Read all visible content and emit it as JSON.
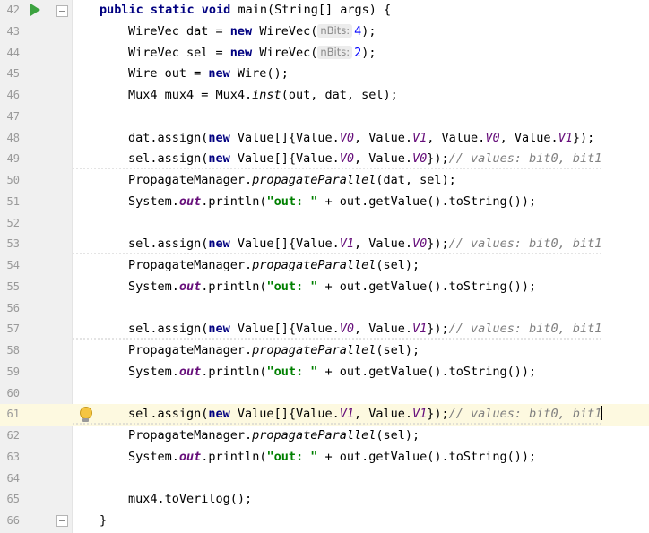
{
  "editor": {
    "line_numbers": [
      "42",
      "43",
      "44",
      "45",
      "46",
      "47",
      "48",
      "49",
      "50",
      "51",
      "52",
      "53",
      "54",
      "55",
      "56",
      "57",
      "58",
      "59",
      "60",
      "61",
      "62",
      "63",
      "64",
      "65",
      "66"
    ],
    "hints": {
      "nbits_label": "nBits:",
      "dat_value": "4",
      "sel_value": "2"
    },
    "code": {
      "l42": {
        "kw": "public static void",
        "rest": " main(String[] args) {"
      },
      "l43": {
        "a": "WireVec dat = ",
        "kw": "new",
        "b": " WireVec(",
        "c": ");"
      },
      "l44": {
        "a": "WireVec sel = ",
        "kw": "new",
        "b": " WireVec(",
        "c": ");"
      },
      "l45": {
        "a": "Wire out = ",
        "kw": "new",
        "b": " Wire();"
      },
      "l46": {
        "a": "Mux4 mux4 = Mux4.",
        "m": "inst",
        "b": "(out, dat, sel);"
      },
      "l48": {
        "a": "dat.assign(",
        "kw": "new",
        "b": " Value[]{Value.",
        "v1": "V0",
        "c": ", Value.",
        "v2": "V1",
        "d": ", Value.",
        "v3": "V0",
        "e": ", Value.",
        "v4": "V1",
        "f": "});"
      },
      "l49": {
        "a": "sel.assign(",
        "kw": "new",
        "b": " Value[]{Value.",
        "v1": "V0",
        "c": ", Value.",
        "v2": "V0",
        "d": "});",
        "cmt": "// values: bit0, bit1"
      },
      "l50": {
        "a": "PropagateManager.",
        "m": "propagateParallel",
        "b": "(dat, sel);"
      },
      "l51": {
        "a": "System.",
        "st": "out",
        "b": ".println(",
        "s": "\"out: \"",
        "c": " + out.getValue().toString());"
      },
      "l53": {
        "a": "sel.assign(",
        "kw": "new",
        "b": " Value[]{Value.",
        "v1": "V1",
        "c": ", Value.",
        "v2": "V0",
        "d": "});",
        "cmt": "// values: bit0, bit1"
      },
      "l54": {
        "a": "PropagateManager.",
        "m": "propagateParallel",
        "b": "(sel);"
      },
      "l55": {
        "a": "System.",
        "st": "out",
        "b": ".println(",
        "s": "\"out: \"",
        "c": " + out.getValue().toString());"
      },
      "l57": {
        "a": "sel.assign(",
        "kw": "new",
        "b": " Value[]{Value.",
        "v1": "V0",
        "c": ", Value.",
        "v2": "V1",
        "d": "});",
        "cmt": "// values: bit0, bit1"
      },
      "l58": {
        "a": "PropagateManager.",
        "m": "propagateParallel",
        "b": "(sel);"
      },
      "l59": {
        "a": "System.",
        "st": "out",
        "b": ".println(",
        "s": "\"out: \"",
        "c": " + out.getValue().toString());"
      },
      "l61": {
        "a": "sel.assign(",
        "kw": "new",
        "b": " Value[]{Value.",
        "v1": "V1",
        "c": ", Value.",
        "v2": "V1",
        "d": "});",
        "cmt": "// values: bit0, bit1"
      },
      "l62": {
        "a": "PropagateManager.",
        "m": "propagateParallel",
        "b": "(sel);"
      },
      "l63": {
        "a": "System.",
        "st": "out",
        "b": ".println(",
        "s": "\"out: \"",
        "c": " + out.getValue().toString());"
      },
      "l65": {
        "a": "mux4.toVerilog();"
      },
      "l66": {
        "a": "}"
      }
    },
    "colors": {
      "keyword": "#000080",
      "constant": "#660e7a",
      "string": "#008000",
      "comment": "#808080",
      "current_line": "#fdf9e0"
    }
  }
}
